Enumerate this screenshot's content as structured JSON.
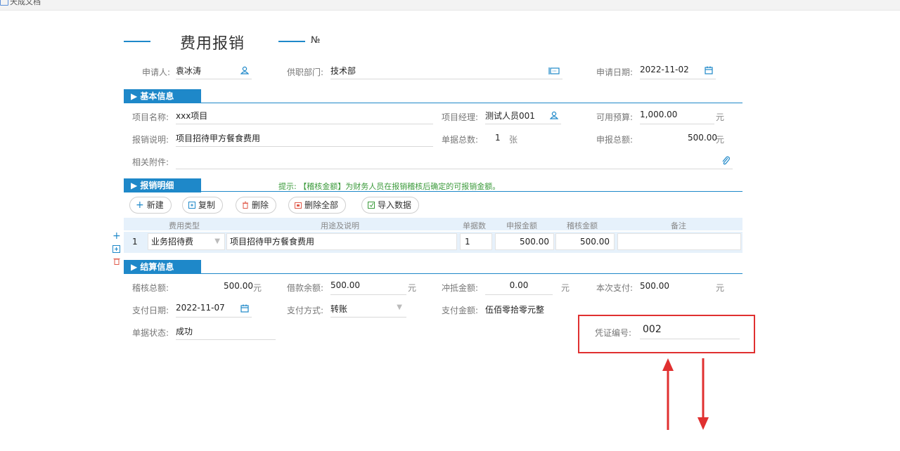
{
  "window": {
    "title": "天成文档"
  },
  "header": {
    "title": "费用报销",
    "no_symbol": "№"
  },
  "top_fields": {
    "applicant_label": "申请人:",
    "applicant_value": "袁冰涛",
    "dept_label": "供职部门:",
    "dept_value": "技术部",
    "date_label": "申请日期:",
    "date_value": "2022-11-02"
  },
  "basic": {
    "section_title": "▶ 基本信息",
    "project_name_label": "项目名称:",
    "project_name_value": "xxx项目",
    "pm_label": "项目经理:",
    "pm_value": "测试人员001",
    "budget_label": "可用预算:",
    "budget_value": "1,000.00",
    "budget_unit": "元",
    "desc_label": "报销说明:",
    "desc_value": "项目招待甲方餐食费用",
    "bills_label": "单据总数:",
    "bills_value": "1",
    "bills_unit": "张",
    "declared_label": "申报总额:",
    "declared_value": "500.00",
    "declared_unit": "元",
    "attach_label": "相关附件:"
  },
  "detail": {
    "section_title": "▶ 报销明细",
    "tip": "提示: 【稽核金额】为财务人员在报销稽核后确定的可报销金额。",
    "buttons": {
      "new": "新建",
      "copy": "复制",
      "delete": "删除",
      "delete_all": "删除全部",
      "import": "导入数据"
    },
    "columns": [
      "费用类型",
      "用途及说明",
      "单据数",
      "申报金额",
      "稽核金额",
      "备注"
    ],
    "rows": [
      {
        "index": "1",
        "type": "业务招待费",
        "desc": "项目招待甲方餐食费用",
        "count": "1",
        "declared": "500.00",
        "audited": "500.00",
        "remark": ""
      }
    ]
  },
  "settle": {
    "section_title": "▶ 结算信息",
    "audit_total_label": "稽核总额:",
    "audit_total_value": "500.00",
    "audit_total_unit": "元",
    "loan_label": "借款余额:",
    "loan_value": "500.00",
    "loan_unit": "元",
    "offset_label": "冲抵金额:",
    "offset_value": "0.00",
    "offset_unit": "元",
    "pay_now_label": "本次支付:",
    "pay_now_value": "500.00",
    "pay_now_unit": "元",
    "pay_date_label": "支付日期:",
    "pay_date_value": "2022-11-07",
    "pay_method_label": "支付方式:",
    "pay_method_value": "转账",
    "pay_amount_label": "支付金额:",
    "pay_amount_value": "伍佰零拾零元整",
    "status_label": "单据状态:",
    "status_value": "成功",
    "voucher_label": "凭证编号:",
    "voucher_value": "002"
  },
  "colors": {
    "accent": "#1e88c9",
    "highlight": "#e03030",
    "tip": "#3a9a3a"
  }
}
